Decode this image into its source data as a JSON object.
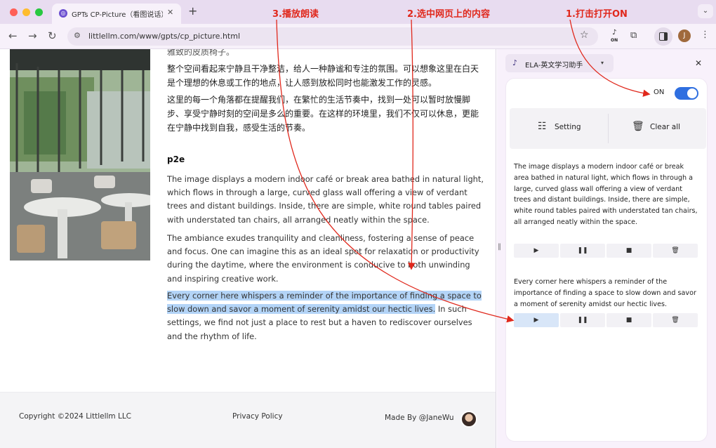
{
  "browser": {
    "tab_title": "GPTs CP-Picture（看图说话）",
    "url": "littlellm.com/www/gpts/cp_picture.html",
    "ext_badge": "ON",
    "profile_initial": "J"
  },
  "article": {
    "zh_partial": "雅致的皮质椅子。",
    "zh_para1": "整个空间看起来宁静且干净整洁，给人一种静谧和专注的氛围。可以想象这里在白天是个理想的休息或工作的地点，让人感到放松同时也能激发工作的灵感。",
    "zh_para2": "这里的每一个角落都在提醒我们，在繁忙的生活节奏中，找到一处可以暂时放慢脚步、享受宁静时刻的空间是多么的重要。在这样的环境里，我们不仅可以休息，更能在宁静中找到自我，感受生活的节奏。",
    "heading": "p2e",
    "en_para1": "The image displays a modern indoor café or break area bathed in natural light, which flows in through a large, curved glass wall offering a view of verdant trees and distant buildings. Inside, there are simple, white round tables paired with understated tan chairs, all arranged neatly within the space.",
    "en_para2": "The ambiance exudes tranquility and cleanliness, fostering a sense of peace and focus. One can imagine this as an ideal spot for relaxation or productivity during the daytime, where the environment is conducive to both unwinding and inspiring creative work.",
    "en_para3_selected": "Every corner here whispers a reminder of the importance of finding a space to slow down and savor a moment of serenity amidst our hectic lives.",
    "en_para3_rest": " In such settings, we find not just a place to rest but a haven to rediscover ourselves and the rhythm of life."
  },
  "footer": {
    "copyright": "Copyright ©2024 Littlellm LLC",
    "privacy": "Privacy Policy",
    "made_by": "Made By @JaneWu"
  },
  "side_panel": {
    "selector_label": "ELA-英文学习助手",
    "toggle_label": "ON",
    "toggle_on": true,
    "setting_label": "Setting",
    "clear_label": "Clear all",
    "entries": [
      {
        "text": "The image displays a modern indoor café or break area bathed in natural light, which flows in through a large, curved glass wall offering a view of verdant trees and distant buildings. Inside, there are simple, white round tables paired with understated tan chairs, all arranged neatly within the space."
      },
      {
        "text": "Every corner here whispers a reminder of the importance of finding a space to slow down and savor a moment of serenity amidst our hectic lives."
      }
    ]
  },
  "annotations": {
    "step1": "1.打击打开ON",
    "step2": "2.选中网页上的内容",
    "step3": "3.播放朗读"
  },
  "colors": {
    "accent": "#2f6fe0",
    "annotation": "#e0281c",
    "selection": "#b3d4f7"
  }
}
